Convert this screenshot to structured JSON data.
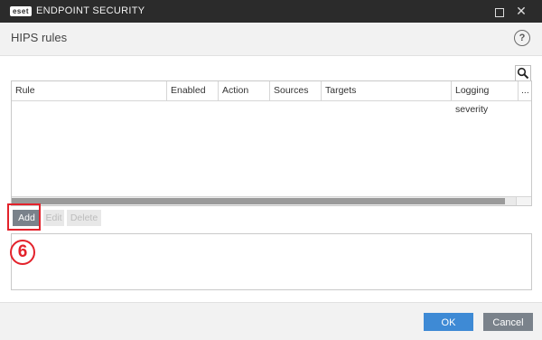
{
  "window": {
    "logo_text": "eset",
    "title": "ENDPOINT SECURITY",
    "maximize_icon": "maximize-icon",
    "close_label": "✕"
  },
  "header": {
    "title": "HIPS rules",
    "help_label": "?"
  },
  "table": {
    "search_icon": "magnifier-icon",
    "columns": [
      "Rule",
      "Enabled",
      "Action",
      "Sources",
      "Targets",
      "Logging severity",
      "..."
    ],
    "rows": []
  },
  "actions": {
    "add_label": "Add",
    "edit_label": "Edit",
    "delete_label": "Delete"
  },
  "annotation": {
    "step_number": "6",
    "color": "#e3222b"
  },
  "footer": {
    "ok_label": "OK",
    "cancel_label": "Cancel"
  },
  "colors": {
    "titlebar": "#2b2b2b",
    "primary_button": "#3e8ad5",
    "secondary_button": "#7a828b"
  }
}
